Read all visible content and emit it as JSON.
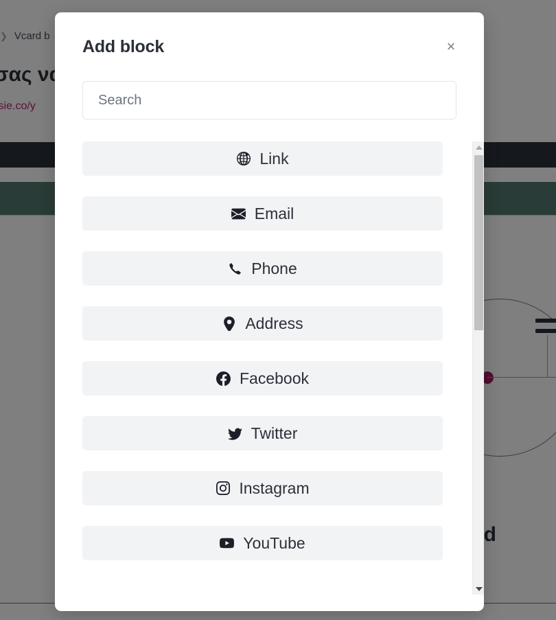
{
  "background": {
    "breadcrumb": {
      "chevron": "chevron-right",
      "label": "Vcard b"
    },
    "heading": "σας να",
    "url": "visie.co/y",
    "big_text_fragment": "ed",
    "colors": {
      "dark_bar": "#2b3038",
      "teal_bar": "#54786f",
      "url_pink": "#b0236b",
      "dot_magenta": "#a01e5e",
      "overlay": "#000000"
    }
  },
  "modal": {
    "title": "Add block",
    "close_label": "×",
    "search": {
      "placeholder": "Search",
      "value": ""
    },
    "blocks": [
      {
        "icon": "globe-icon",
        "label": "Link"
      },
      {
        "icon": "envelope-icon",
        "label": "Email"
      },
      {
        "icon": "phone-icon",
        "label": "Phone"
      },
      {
        "icon": "map-pin-icon",
        "label": "Address"
      },
      {
        "icon": "facebook-icon",
        "label": "Facebook"
      },
      {
        "icon": "twitter-icon",
        "label": "Twitter"
      },
      {
        "icon": "instagram-icon",
        "label": "Instagram"
      },
      {
        "icon": "youtube-icon",
        "label": "YouTube"
      }
    ],
    "scrollbar": {
      "up_arrow": "scroll-up",
      "down_arrow": "scroll-down",
      "thumb": "scroll-thumb"
    }
  }
}
